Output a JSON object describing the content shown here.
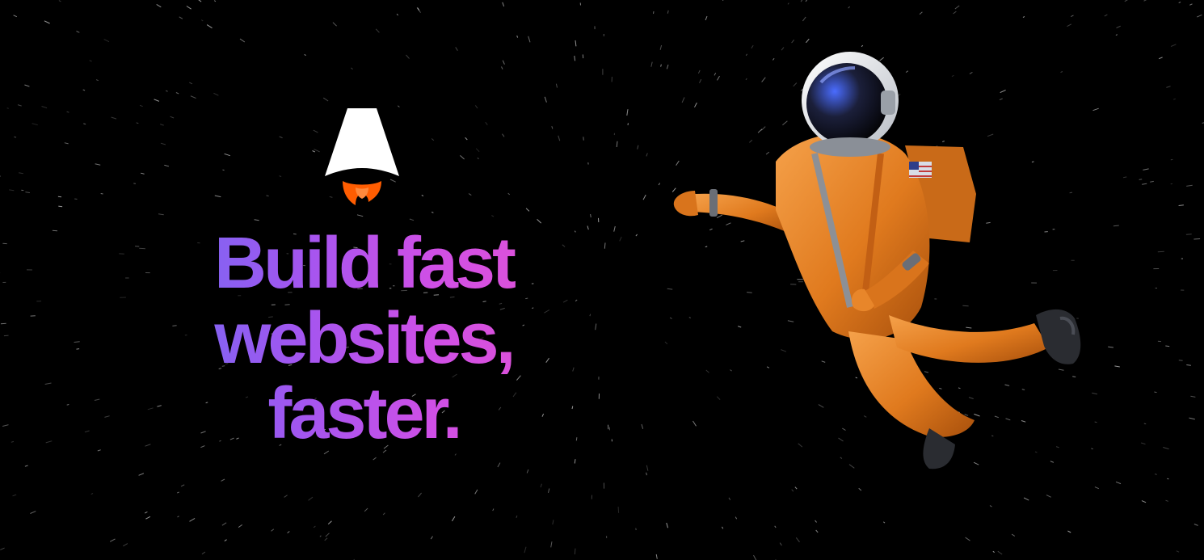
{
  "hero": {
    "headline_lines": [
      "Build fast",
      "websites,",
      "faster."
    ]
  },
  "logo": {
    "icon": "astro-rocket-logo-icon",
    "primary_color": "#ffffff",
    "flame_color": "#ff5d01"
  },
  "illustration": {
    "icon": "astronaut-illustration",
    "suit_color": "#e8862a"
  },
  "colors": {
    "background": "#000000",
    "gradient_start": "#6f6cf2",
    "gradient_end": "#e553d2"
  }
}
